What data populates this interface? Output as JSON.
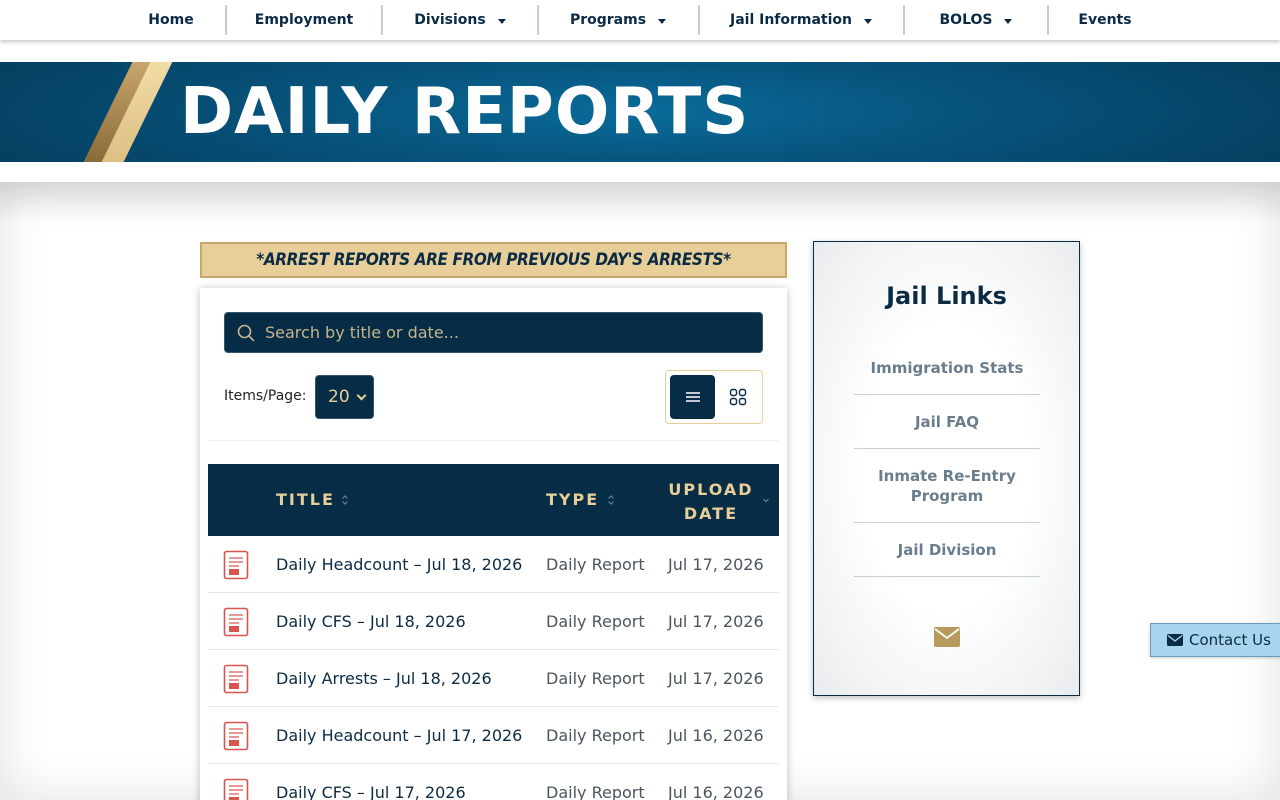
{
  "nav": {
    "items": [
      {
        "label": "Home",
        "dropdown": false
      },
      {
        "label": "Employment",
        "dropdown": false
      },
      {
        "label": "Divisions",
        "dropdown": true
      },
      {
        "label": "Programs",
        "dropdown": true
      },
      {
        "label": "Jail Information",
        "dropdown": true
      },
      {
        "label": "BOLOS",
        "dropdown": true
      },
      {
        "label": "Events",
        "dropdown": false
      }
    ]
  },
  "banner": {
    "title": "DAILY REPORTS"
  },
  "notice": {
    "text": "*ARREST REPORTS ARE FROM PREVIOUS DAY'S ARRESTS*"
  },
  "search": {
    "placeholder": "Search by title or date..."
  },
  "pagination": {
    "items_label": "Items/Page:",
    "items_value": "20"
  },
  "table": {
    "headers": {
      "title": "TITLE",
      "type": "TYPE",
      "upload_date_line1": "UPLOAD",
      "upload_date_line2": "DATE"
    },
    "rows": [
      {
        "title": "Daily Headcount – Jul 18, 2026",
        "type": "Daily Report",
        "date": "Jul 17, 2026"
      },
      {
        "title": "Daily CFS – Jul 18, 2026",
        "type": "Daily Report",
        "date": "Jul 17, 2026"
      },
      {
        "title": "Daily Arrests – Jul 18, 2026",
        "type": "Daily Report",
        "date": "Jul 17, 2026"
      },
      {
        "title": "Daily Headcount – Jul 17, 2026",
        "type": "Daily Report",
        "date": "Jul 16, 2026"
      },
      {
        "title": "Daily CFS – Jul 17, 2026",
        "type": "Daily Report",
        "date": "Jul 16, 2026"
      }
    ]
  },
  "sidebar": {
    "title": "Jail Links",
    "links": [
      {
        "line1": "Immigration Stats",
        "line2": ""
      },
      {
        "line1": "Jail FAQ",
        "line2": ""
      },
      {
        "line1": "Inmate Re-Entry",
        "line2": "Program"
      },
      {
        "line1": "Jail Division",
        "line2": ""
      }
    ]
  },
  "contact": {
    "label": "Contact Us"
  },
  "colors": {
    "navy": "#062d45",
    "gold": "#e8cf99",
    "banner_blue": "#07557e",
    "pdf_red": "#d9534f"
  }
}
